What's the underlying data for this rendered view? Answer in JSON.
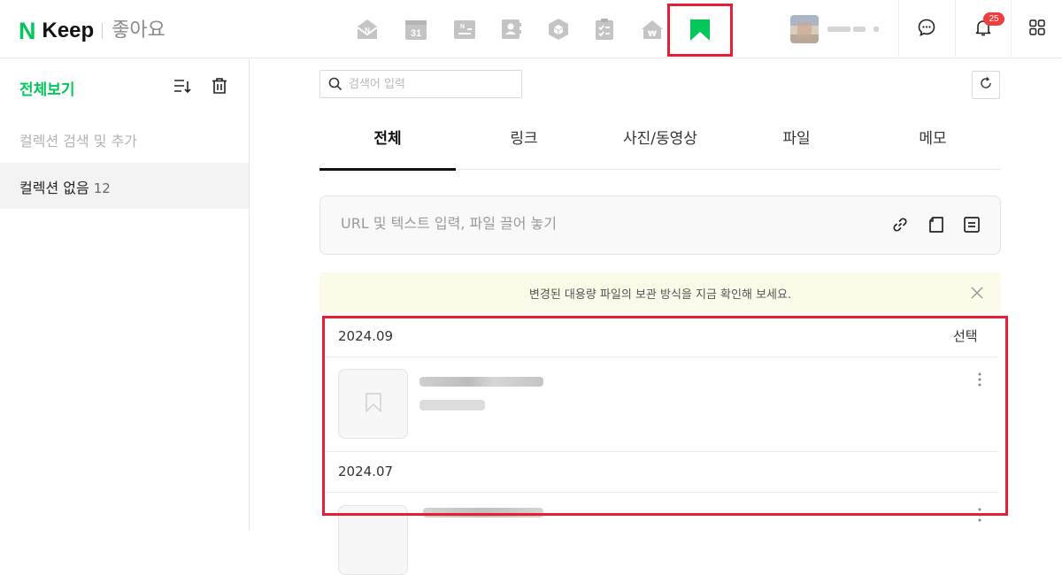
{
  "header": {
    "brand_n": "N",
    "brand_keep": "Keep",
    "brand_sub": "좋아요",
    "services": [
      {
        "name": "mail-service-icon",
        "glyph": "mail"
      },
      {
        "name": "calendar-service-icon",
        "glyph": "calendar",
        "text": "31"
      },
      {
        "name": "memo-service-icon",
        "glyph": "memo"
      },
      {
        "name": "contacts-service-icon",
        "glyph": "contacts"
      },
      {
        "name": "mybox-service-icon",
        "glyph": "box"
      },
      {
        "name": "todo-service-icon",
        "glyph": "todo"
      },
      {
        "name": "pay-service-icon",
        "glyph": "won"
      },
      {
        "name": "keep-service-icon",
        "glyph": "keep",
        "active": true
      }
    ],
    "notification_count": "25"
  },
  "sidebar": {
    "title": "전체보기",
    "search_placeholder": "컬렉션 검색 및 추가",
    "items": [
      {
        "label": "컬렉션 없음",
        "count": "12"
      }
    ]
  },
  "main": {
    "search_placeholder": "검색어 입력",
    "tabs": [
      {
        "label": "전체",
        "active": true
      },
      {
        "label": "링크"
      },
      {
        "label": "사진/동영상"
      },
      {
        "label": "파일"
      },
      {
        "label": "메모"
      }
    ],
    "input_placeholder": "URL 및 텍스트 입력, 파일 끌어 놓기",
    "notice": "변경된 대용량 파일의 보관 방식을 지금 확인해 보세요.",
    "select_label": "선택",
    "groups": [
      {
        "date": "2024.09"
      },
      {
        "date": "2024.07"
      }
    ]
  },
  "colors": {
    "brand_green": "#03c75a",
    "highlight_red": "#e31e36",
    "badge_red": "#f03e3e",
    "notice_bg": "#fcfbe9"
  }
}
